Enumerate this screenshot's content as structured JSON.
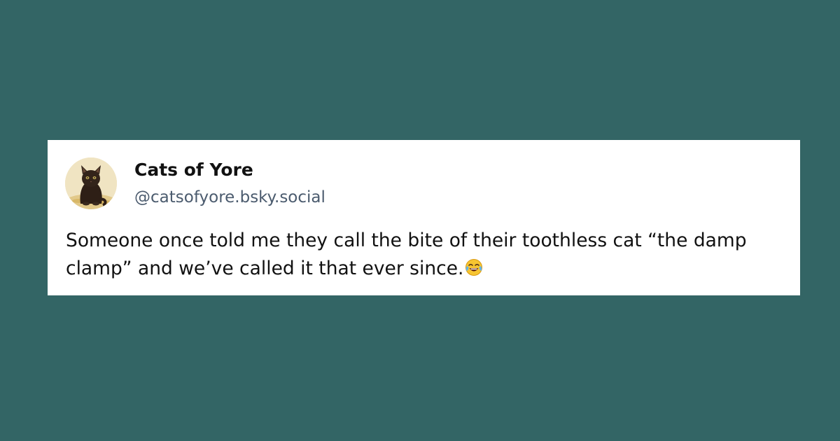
{
  "post": {
    "author": {
      "display_name": "Cats of Yore",
      "handle": "@catsofyore.bsky.social",
      "avatar_icon": "black-kitten-avatar"
    },
    "text": "Someone once told me they call the bite of their toothless cat “the damp clamp” and we’ve called it that ever since.",
    "emoji_icon": "face-with-tears-of-joy-icon"
  },
  "colors": {
    "background": "#336565",
    "card": "#ffffff",
    "name": "#111111",
    "handle": "#4b5b6e",
    "text": "#111111"
  }
}
